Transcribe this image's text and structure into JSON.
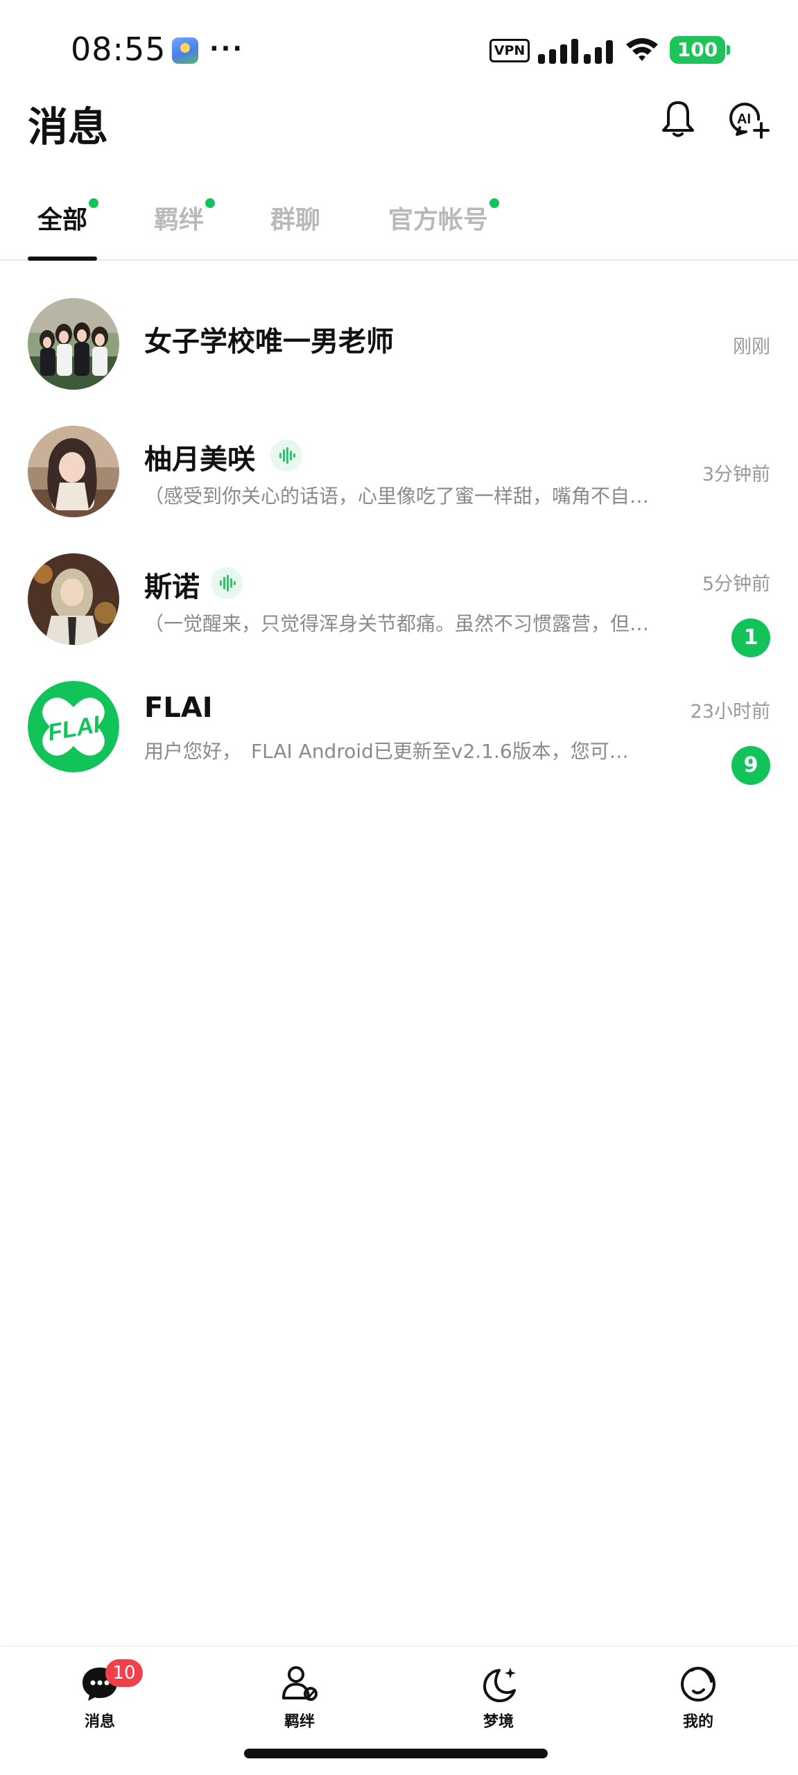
{
  "status_bar": {
    "time": "08:55",
    "more": "···",
    "vpn": "VPN",
    "battery": "100",
    "icons": [
      "app-notification-icon",
      "signal-icon",
      "wifi-icon",
      "battery-icon"
    ]
  },
  "header": {
    "title": "消息",
    "icons": [
      "bell-icon",
      "ai-add-icon"
    ]
  },
  "tabs": [
    {
      "label": "全部",
      "active": true,
      "dot": true
    },
    {
      "label": "羁绊",
      "active": false,
      "dot": true
    },
    {
      "label": "群聊",
      "active": false,
      "dot": false
    },
    {
      "label": "官方帐号",
      "active": false,
      "dot": true
    }
  ],
  "chats": [
    {
      "name": "女子学校唯一男老师",
      "preview": "",
      "time": "刚刚",
      "unread": "",
      "voice": false
    },
    {
      "name": "柚月美咲",
      "preview": "（感受到你关心的话语，心里像吃了蜜一样甜，嘴角不自…",
      "time": "3分钟前",
      "unread": "",
      "voice": true
    },
    {
      "name": "斯诺",
      "preview": "（一觉醒来，只觉得浑身关节都痛。虽然不习惯露营，但…",
      "time": "5分钟前",
      "unread": "1",
      "voice": true
    },
    {
      "name": "FLAI",
      "preview": "用户您好，　FLAI Android已更新至v2.1.6版本，您可…",
      "time": "23小时前",
      "unread": "9",
      "voice": false
    }
  ],
  "flai_logo_text": "FLAI",
  "bottom_nav": [
    {
      "label": "消息",
      "icon": "chat-bubble-icon",
      "badge": "10"
    },
    {
      "label": "羁绊",
      "icon": "people-icon",
      "badge": ""
    },
    {
      "label": "梦境",
      "icon": "moon-sparkle-icon",
      "badge": ""
    },
    {
      "label": "我的",
      "icon": "profile-icon",
      "badge": ""
    }
  ],
  "colors": {
    "accent": "#12c35a",
    "badge_red": "#f0404a",
    "inactive_tab": "#b9b9b9",
    "preview_text": "#8a8a8a"
  }
}
